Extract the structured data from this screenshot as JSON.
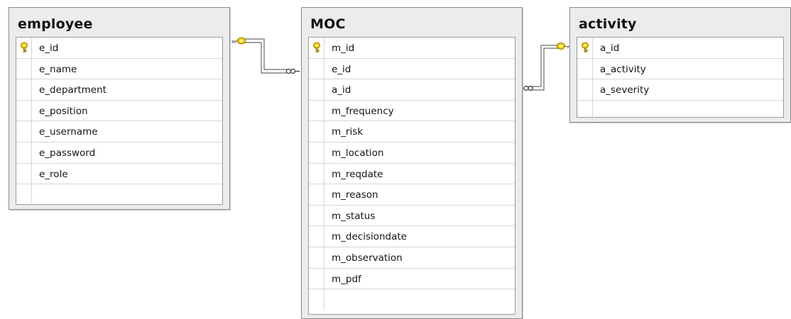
{
  "diagram": {
    "tables": [
      {
        "name": "employee",
        "columns": [
          {
            "name": "e_id",
            "primary_key": true
          },
          {
            "name": "e_name",
            "primary_key": false
          },
          {
            "name": "e_department",
            "primary_key": false
          },
          {
            "name": "e_position",
            "primary_key": false
          },
          {
            "name": "e_username",
            "primary_key": false
          },
          {
            "name": "e_password",
            "primary_key": false
          },
          {
            "name": "e_role",
            "primary_key": false
          }
        ]
      },
      {
        "name": "MOC",
        "columns": [
          {
            "name": "m_id",
            "primary_key": true
          },
          {
            "name": "e_id",
            "primary_key": false
          },
          {
            "name": "a_id",
            "primary_key": false
          },
          {
            "name": "m_frequency",
            "primary_key": false
          },
          {
            "name": "m_risk",
            "primary_key": false
          },
          {
            "name": "m_location",
            "primary_key": false
          },
          {
            "name": "m_reqdate",
            "primary_key": false
          },
          {
            "name": "m_reason",
            "primary_key": false
          },
          {
            "name": "m_status",
            "primary_key": false
          },
          {
            "name": "m_decisiondate",
            "primary_key": false
          },
          {
            "name": "m_observation",
            "primary_key": false
          },
          {
            "name": "m_pdf",
            "primary_key": false
          }
        ]
      },
      {
        "name": "activity",
        "columns": [
          {
            "name": "a_id",
            "primary_key": true
          },
          {
            "name": "a_activity",
            "primary_key": false
          },
          {
            "name": "a_severity",
            "primary_key": false
          }
        ]
      }
    ],
    "relationships": [
      {
        "from_table": "employee",
        "to_table": "MOC",
        "from_end": "key",
        "to_end": "infinity"
      },
      {
        "from_table": "activity",
        "to_table": "MOC",
        "from_end": "key",
        "to_end": "infinity"
      }
    ],
    "colors": {
      "table_frame": "#ececec",
      "grid_background": "#ffffff",
      "border": "#8a8a8a",
      "row_line": "#d6d6d6",
      "key_gold": "#e8c200",
      "connector": "#6b6b6b"
    }
  }
}
